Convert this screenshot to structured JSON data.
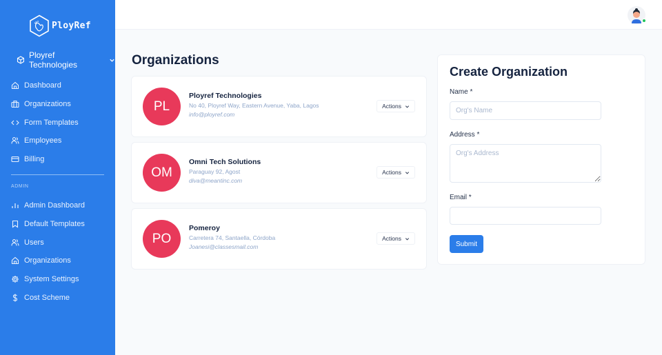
{
  "brand": {
    "name": "PloyRef"
  },
  "org_switcher": {
    "label": "Ployref Technologies"
  },
  "sidebar": {
    "main_items": [
      {
        "label": "Dashboard",
        "icon": "home-icon"
      },
      {
        "label": "Organizations",
        "icon": "briefcase-icon"
      },
      {
        "label": "Form Templates",
        "icon": "code-icon"
      },
      {
        "label": "Employees",
        "icon": "users-icon"
      },
      {
        "label": "Billing",
        "icon": "credit-card-icon"
      }
    ],
    "admin_label": "ADMIN",
    "admin_items": [
      {
        "label": "Admin Dashboard",
        "icon": "bar-chart-icon"
      },
      {
        "label": "Default Templates",
        "icon": "bookmark-icon"
      },
      {
        "label": "Users",
        "icon": "users-icon"
      },
      {
        "label": "Organizations",
        "icon": "home-icon"
      },
      {
        "label": "System Settings",
        "icon": "gear-icon"
      },
      {
        "label": "Cost Scheme",
        "icon": "dollar-icon"
      }
    ]
  },
  "main": {
    "title": "Organizations",
    "organizations": [
      {
        "initials": "PL",
        "name": "Ployref Technologies",
        "address": "No 40, Ployref Way, Eastern Avenue, Yaba, Lagos",
        "email": "info@ployref.com",
        "actions_label": "Actions"
      },
      {
        "initials": "OM",
        "name": "Omni Tech Solutions",
        "address": "Paraguay 92, Agost",
        "email": "diva@meantinc.com",
        "actions_label": "Actions"
      },
      {
        "initials": "PO",
        "name": "Pomeroy",
        "address": "Carretera 74, Santaella, Córdoba",
        "email": "Joanesi@classesmail.com",
        "actions_label": "Actions"
      }
    ]
  },
  "create_form": {
    "title": "Create Organization",
    "name_label": "Name *",
    "name_placeholder": "Org's Name",
    "name_value": "",
    "address_label": "Address *",
    "address_placeholder": "Org's Address",
    "address_value": "",
    "email_label": "Email *",
    "email_placeholder": "",
    "email_value": "",
    "submit_label": "Submit"
  },
  "colors": {
    "sidebar": "#2b7de9",
    "accent": "#2b7de9",
    "org_avatar": "#e8395a",
    "online_status": "#22c55e"
  }
}
